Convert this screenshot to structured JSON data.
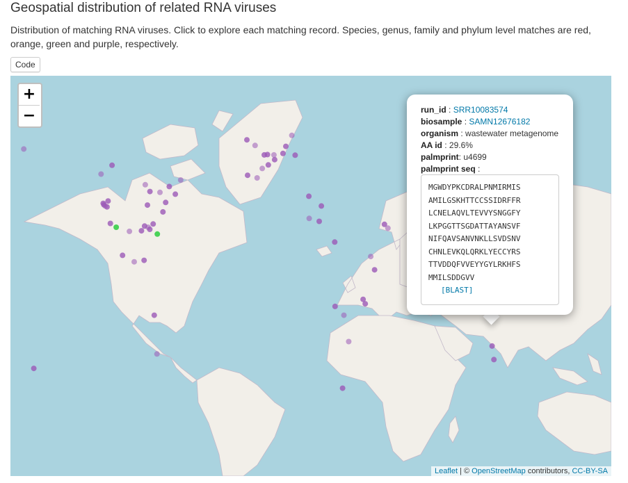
{
  "page": {
    "title": "Geospatial distribution of related RNA viruses",
    "description": "Distribution of matching RNA viruses. Click to explore each matching record. Species, genus, family and phylum level matches are red, orange, green and purple, respectively.",
    "code_button": "Code"
  },
  "colors": {
    "ocean": "#aad3df",
    "land": "#f2efe9",
    "purple": "#9b59b6",
    "green": "#2ecc40",
    "link": "#0078a8"
  },
  "map": {
    "zoom_in": "+",
    "zoom_out": "−",
    "attribution": {
      "leaflet": "Leaflet",
      "sep1": " | © ",
      "osm": "OpenStreetMap",
      "mid": " contributors, ",
      "license": "CC-BY-SA"
    }
  },
  "popup": {
    "run_id_label": "run_id",
    "run_id": "SRR10083574",
    "biosample_label": "biosample",
    "biosample": "SAMN12676182",
    "organism_label": "organism",
    "organism": "wastewater metagenome",
    "aa_label": "AA id",
    "aa_id": "29.6%",
    "palmprint_label": "palmprint",
    "palmprint": "u4699",
    "seq_label": "palmprint seq",
    "sequence": [
      "MGWDYPKCDRALPNMIRMIS",
      "AMILGSKHTTCCSSIDRFFR",
      "LCNELAQVLTEVVYSNGGFY",
      "LKPGGTTSGDATTAYANSVF",
      "NIFQAVSANVNKLLSVDSNV",
      "CHNLEVKQLQRKLYECCYRS",
      "TTVDDQFVVEYYGYLRKHFS",
      "MMILSDDGVV"
    ],
    "blast": "[BLAST]"
  },
  "markers": [
    {
      "lat": 46.5,
      "lon": -171.6,
      "level": "phylum"
    },
    {
      "lat": 28.1,
      "lon": -124.0,
      "level": "phylum"
    },
    {
      "lat": 27.6,
      "lon": -123.6,
      "level": "phylum"
    },
    {
      "lat": 27.2,
      "lon": -122.8,
      "level": "phylum"
    },
    {
      "lat": 26.9,
      "lon": -121.7,
      "level": "phylum"
    },
    {
      "lat": 28.9,
      "lon": -121.1,
      "level": "phylum"
    },
    {
      "lat": 38.0,
      "lon": -125.3,
      "level": "phylum"
    },
    {
      "lat": 21.3,
      "lon": -119.7,
      "level": "phylum"
    },
    {
      "lat": 20.0,
      "lon": -116.2,
      "level": "green"
    },
    {
      "lat": 18.6,
      "lon": -108.3,
      "level": "phylum"
    },
    {
      "lat": 18.8,
      "lon": -101.1,
      "level": "phylum"
    },
    {
      "lat": 20.4,
      "lon": -99.2,
      "level": "phylum"
    },
    {
      "lat": 20.0,
      "lon": -97.1,
      "level": "phylum"
    },
    {
      "lat": 19.3,
      "lon": -96.1,
      "level": "phylum"
    },
    {
      "lat": 21.1,
      "lon": -94.1,
      "level": "phylum"
    },
    {
      "lat": 17.7,
      "lon": -91.6,
      "level": "green"
    },
    {
      "lat": 25.2,
      "lon": -88.2,
      "level": "phylum"
    },
    {
      "lat": 28.4,
      "lon": -86.6,
      "level": "phylum"
    },
    {
      "lat": 34.4,
      "lon": -98.8,
      "level": "phylum"
    },
    {
      "lat": 32.1,
      "lon": -96.0,
      "level": "phylum"
    },
    {
      "lat": 27.5,
      "lon": -97.5,
      "level": "phylum"
    },
    {
      "lat": 31.8,
      "lon": -90.0,
      "level": "phylum"
    },
    {
      "lat": 31.2,
      "lon": -80.8,
      "level": "phylum"
    },
    {
      "lat": 33.8,
      "lon": -84.4,
      "level": "phylum"
    },
    {
      "lat": 36.0,
      "lon": -77.6,
      "level": "phylum"
    },
    {
      "lat": 41.0,
      "lon": -118.7,
      "level": "phylum"
    },
    {
      "lat": 10.5,
      "lon": -112.4,
      "level": "phylum"
    },
    {
      "lat": 8.3,
      "lon": -105.4,
      "level": "phylum"
    },
    {
      "lat": 8.8,
      "lon": -99.5,
      "level": "phylum"
    },
    {
      "lat": -9.8,
      "lon": -93.4,
      "level": "phylum"
    },
    {
      "lat": -22.9,
      "lon": -91.8,
      "level": "phylum"
    },
    {
      "lat": -27.8,
      "lon": -165.6,
      "level": "phylum"
    },
    {
      "lat": 49.6,
      "lon": -37.9,
      "level": "phylum"
    },
    {
      "lat": 47.7,
      "lon": -33.0,
      "level": "phylum"
    },
    {
      "lat": 44.5,
      "lon": -27.5,
      "level": "phylum"
    },
    {
      "lat": 44.6,
      "lon": -25.6,
      "level": "phylum"
    },
    {
      "lat": 44.5,
      "lon": -21.7,
      "level": "phylum"
    },
    {
      "lat": 42.9,
      "lon": -21.3,
      "level": "phylum"
    },
    {
      "lat": 41.1,
      "lon": -25.1,
      "level": "phylum"
    },
    {
      "lat": 39.9,
      "lon": -28.7,
      "level": "phylum"
    },
    {
      "lat": 45.0,
      "lon": -16.3,
      "level": "phylum"
    },
    {
      "lat": 47.4,
      "lon": -14.6,
      "level": "phylum"
    },
    {
      "lat": 51.1,
      "lon": -11.0,
      "level": "phylum"
    },
    {
      "lat": 44.4,
      "lon": -9.0,
      "level": "phylum"
    },
    {
      "lat": 37.6,
      "lon": -37.5,
      "level": "phylum"
    },
    {
      "lat": 36.7,
      "lon": -31.8,
      "level": "phylum"
    },
    {
      "lat": 30.5,
      "lon": -0.8,
      "level": "phylum"
    },
    {
      "lat": 27.2,
      "lon": 6.7,
      "level": "phylum"
    },
    {
      "lat": 23.0,
      "lon": -0.6,
      "level": "phylum"
    },
    {
      "lat": 22.0,
      "lon": 5.4,
      "level": "phylum"
    },
    {
      "lat": 15.0,
      "lon": 14.7,
      "level": "phylum"
    },
    {
      "lat": 10.1,
      "lon": 36.3,
      "level": "phylum"
    },
    {
      "lat": 5.6,
      "lon": 38.6,
      "level": "phylum"
    },
    {
      "lat": -6.8,
      "lon": 14.9,
      "level": "phylum"
    },
    {
      "lat": -9.8,
      "lon": 20.2,
      "level": "phylum"
    },
    {
      "lat": -5.9,
      "lon": 33.0,
      "level": "phylum"
    },
    {
      "lat": -4.4,
      "lon": 31.7,
      "level": "phylum"
    },
    {
      "lat": -18.7,
      "lon": 23.1,
      "level": "phylum"
    },
    {
      "lat": -34.5,
      "lon": 19.4,
      "level": "phylum"
    },
    {
      "lat": 21.0,
      "lon": 44.5,
      "level": "phylum"
    },
    {
      "lat": 19.7,
      "lon": 46.6,
      "level": "phylum"
    },
    {
      "lat": 13.1,
      "lon": 63.0,
      "level": "phylum"
    },
    {
      "lat": 8.3,
      "lon": 65.2,
      "level": "phylum"
    },
    {
      "lat": 24.1,
      "lon": 64.1,
      "level": "phylum"
    },
    {
      "lat": 17.5,
      "lon": 95.3,
      "level": "phylum"
    },
    {
      "lat": 19.5,
      "lon": 104.5,
      "level": "phylum"
    },
    {
      "lat": 18.6,
      "lon": 107.8,
      "level": "phylum"
    },
    {
      "lat": 13.8,
      "lon": 96.8,
      "level": "phylum"
    },
    {
      "lat": 12.3,
      "lon": 100.6,
      "level": "phylum"
    },
    {
      "lat": 9.4,
      "lon": 95.7,
      "level": "green"
    },
    {
      "lat": 7.3,
      "lon": 95.3,
      "level": "phylum"
    },
    {
      "lat": 3.8,
      "lon": 97.9,
      "level": "phylum"
    },
    {
      "lat": 31.9,
      "lon": 112.6,
      "level": "green"
    },
    {
      "lat": 31.6,
      "lon": 110.7,
      "level": "green"
    },
    {
      "lat": 28.8,
      "lon": 117.2,
      "level": "phylum"
    },
    {
      "lat": 33.4,
      "lon": 118.5,
      "level": "green"
    },
    {
      "lat": 23.0,
      "lon": 110.3,
      "level": "phylum"
    },
    {
      "lat": 28.1,
      "lon": 102.6,
      "level": "phylum"
    },
    {
      "lat": 13.0,
      "lon": 108.6,
      "level": "phylum"
    },
    {
      "lat": -20.2,
      "lon": 109.0,
      "level": "phylum"
    },
    {
      "lat": -24.8,
      "lon": 110.1,
      "level": "phylum"
    },
    {
      "lat": 24.5,
      "lon": 60.7,
      "level": "phylum"
    }
  ]
}
